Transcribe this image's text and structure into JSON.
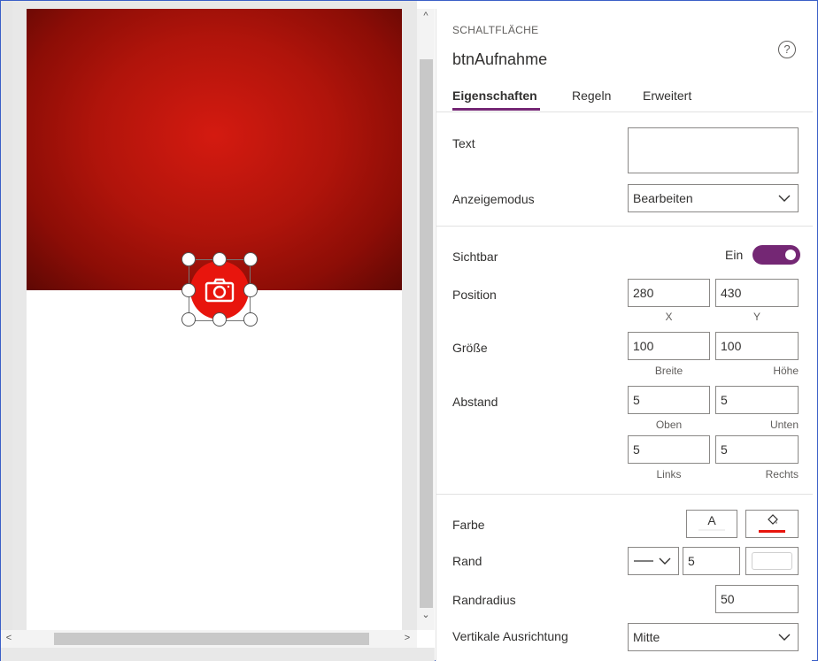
{
  "canvas": {
    "scroll_up": "^",
    "scroll_down": "⌄",
    "scroll_left": "<",
    "scroll_right": ">"
  },
  "panel": {
    "overline": "SCHALTFLÄCHE",
    "title": "btnAufnahme",
    "help": "?",
    "tabs": [
      "Eigenschaften",
      "Regeln",
      "Erweitert"
    ],
    "text_label": "Text",
    "text_value": "",
    "display_mode_label": "Anzeigemodus",
    "display_mode_value": "Bearbeiten",
    "visible_label": "Sichtbar",
    "visible_value": "Ein",
    "position_label": "Position",
    "position_x": "280",
    "position_y": "430",
    "x_label": "X",
    "y_label": "Y",
    "size_label": "Größe",
    "width": "100",
    "height": "100",
    "width_label": "Breite",
    "height_label": "Höhe",
    "padding_label": "Abstand",
    "pad_top": "5",
    "pad_bottom": "5",
    "pad_left": "5",
    "pad_right": "5",
    "top_label": "Oben",
    "bottom_label": "Unten",
    "left_label": "Links",
    "right_label": "Rechts",
    "color_label": "Farbe",
    "color_text_btn": "A",
    "border_label": "Rand",
    "border_width": "5",
    "radius_label": "Randradius",
    "radius_value": "50",
    "valign_label": "Vertikale Ausrichtung",
    "valign_value": "Mitte"
  },
  "colors": {
    "accent": "#742774",
    "button_fill": "#e8150d"
  }
}
